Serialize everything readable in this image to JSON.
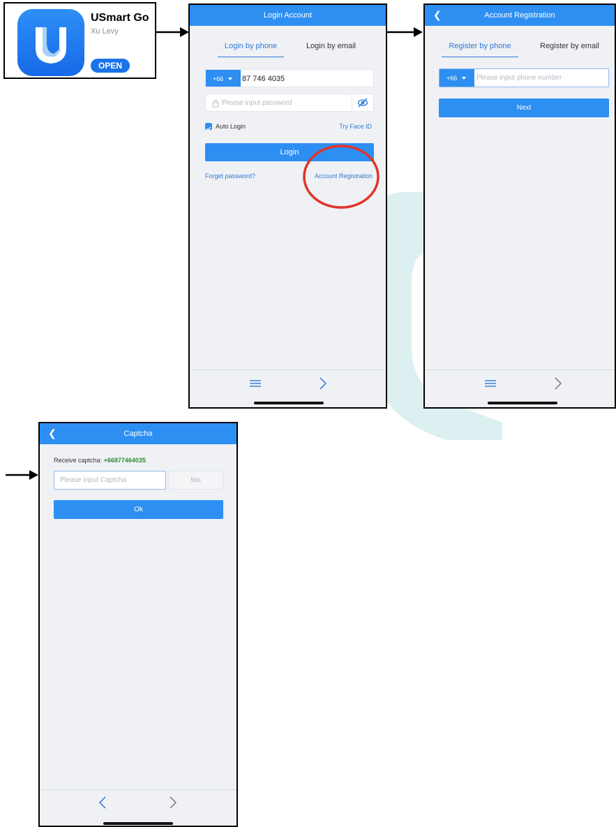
{
  "app_card": {
    "name": "USmart Go",
    "developer": "Xu Levy",
    "open_label": "OPEN"
  },
  "login_screen": {
    "title": "Login Account",
    "tabs": [
      "Login by phone",
      "Login by email"
    ],
    "country_code": "+66",
    "phone_value": "87 746 4035",
    "password_placeholder": "Please input password",
    "auto_login_label": "Auto Login",
    "face_id_label": "Try Face ID",
    "login_button": "Login",
    "forget_password": "Forget password?",
    "account_registration": "Account Registration"
  },
  "registration_screen": {
    "title": "Account Registration",
    "tabs": [
      "Register by phone",
      "Register by email"
    ],
    "country_code": "+66",
    "phone_placeholder": "Please input phone number",
    "next_button": "Next"
  },
  "captcha_screen": {
    "title": "Captcha",
    "receive_label": "Receive captcha:",
    "receive_number": "+66877464035",
    "captcha_placeholder": "Please input Captcha",
    "countdown": "56s",
    "ok_button": "Ok"
  },
  "colors": {
    "brand_blue": "#2d8ff2",
    "link_blue": "#2d7ad6",
    "highlight_circle": "#e0342c",
    "captcha_number_green": "#2e8b2e",
    "app_store_blue": "#1a73e8"
  },
  "icons": [
    "usmart-logo-icon",
    "eye-off-icon",
    "lock-icon",
    "checkbox-checked-icon",
    "menu-icon",
    "forward-chevron-icon",
    "back-chevron-icon",
    "flow-arrow-icon"
  ]
}
